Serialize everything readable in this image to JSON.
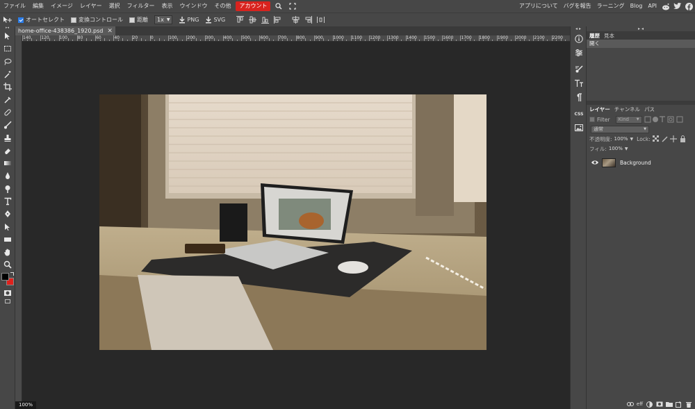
{
  "menu": {
    "items": [
      "ファイル",
      "編集",
      "イメージ",
      "レイヤー",
      "選択",
      "フィルター",
      "表示",
      "ウインドウ",
      "その他"
    ],
    "account": "アカウント",
    "right_links": [
      "アプリについて",
      "バグを報告",
      "ラーニング",
      "Blog",
      "API"
    ]
  },
  "options": {
    "auto_select": "オートセレクト",
    "transform_controls": "変換コントロール",
    "distance": "距離",
    "scale": "1x",
    "png": "PNG",
    "svg": "SVG"
  },
  "document": {
    "tab_name": "home-office-438386_1920.psd",
    "close": "✕",
    "zoom": "100%",
    "ruler_labels": [
      "140",
      "120",
      "100",
      "80",
      "60",
      "40",
      "20",
      "0",
      "100",
      "200",
      "300",
      "400",
      "500",
      "600",
      "700",
      "800",
      "900",
      "1000",
      "1100",
      "1200",
      "1300",
      "1400",
      "1500",
      "1600",
      "1700",
      "1800",
      "1900",
      "2000",
      "2100",
      "2200"
    ]
  },
  "history_panel": {
    "tabs": [
      "履歴",
      "見本"
    ],
    "items": [
      "開く"
    ]
  },
  "layers_panel": {
    "tabs": [
      "レイヤー",
      "チャンネル",
      "パス"
    ],
    "filter_label": "Filter",
    "kind_label": "Kind",
    "blend_mode": "通常",
    "opacity_label": "不透明度:",
    "opacity_value": "100%",
    "lock_label": "Lock:",
    "fill_label": "フィル:",
    "fill_value": "100%",
    "layers": [
      {
        "name": "Background"
      }
    ]
  },
  "mid_panel": {
    "css_label": "CSS"
  },
  "footer_icons": [
    "link-icon",
    "effects-icon",
    "adjustment-icon",
    "mask-icon",
    "folder-icon",
    "new-layer-icon",
    "trash-icon"
  ],
  "footer_eff": "eff"
}
